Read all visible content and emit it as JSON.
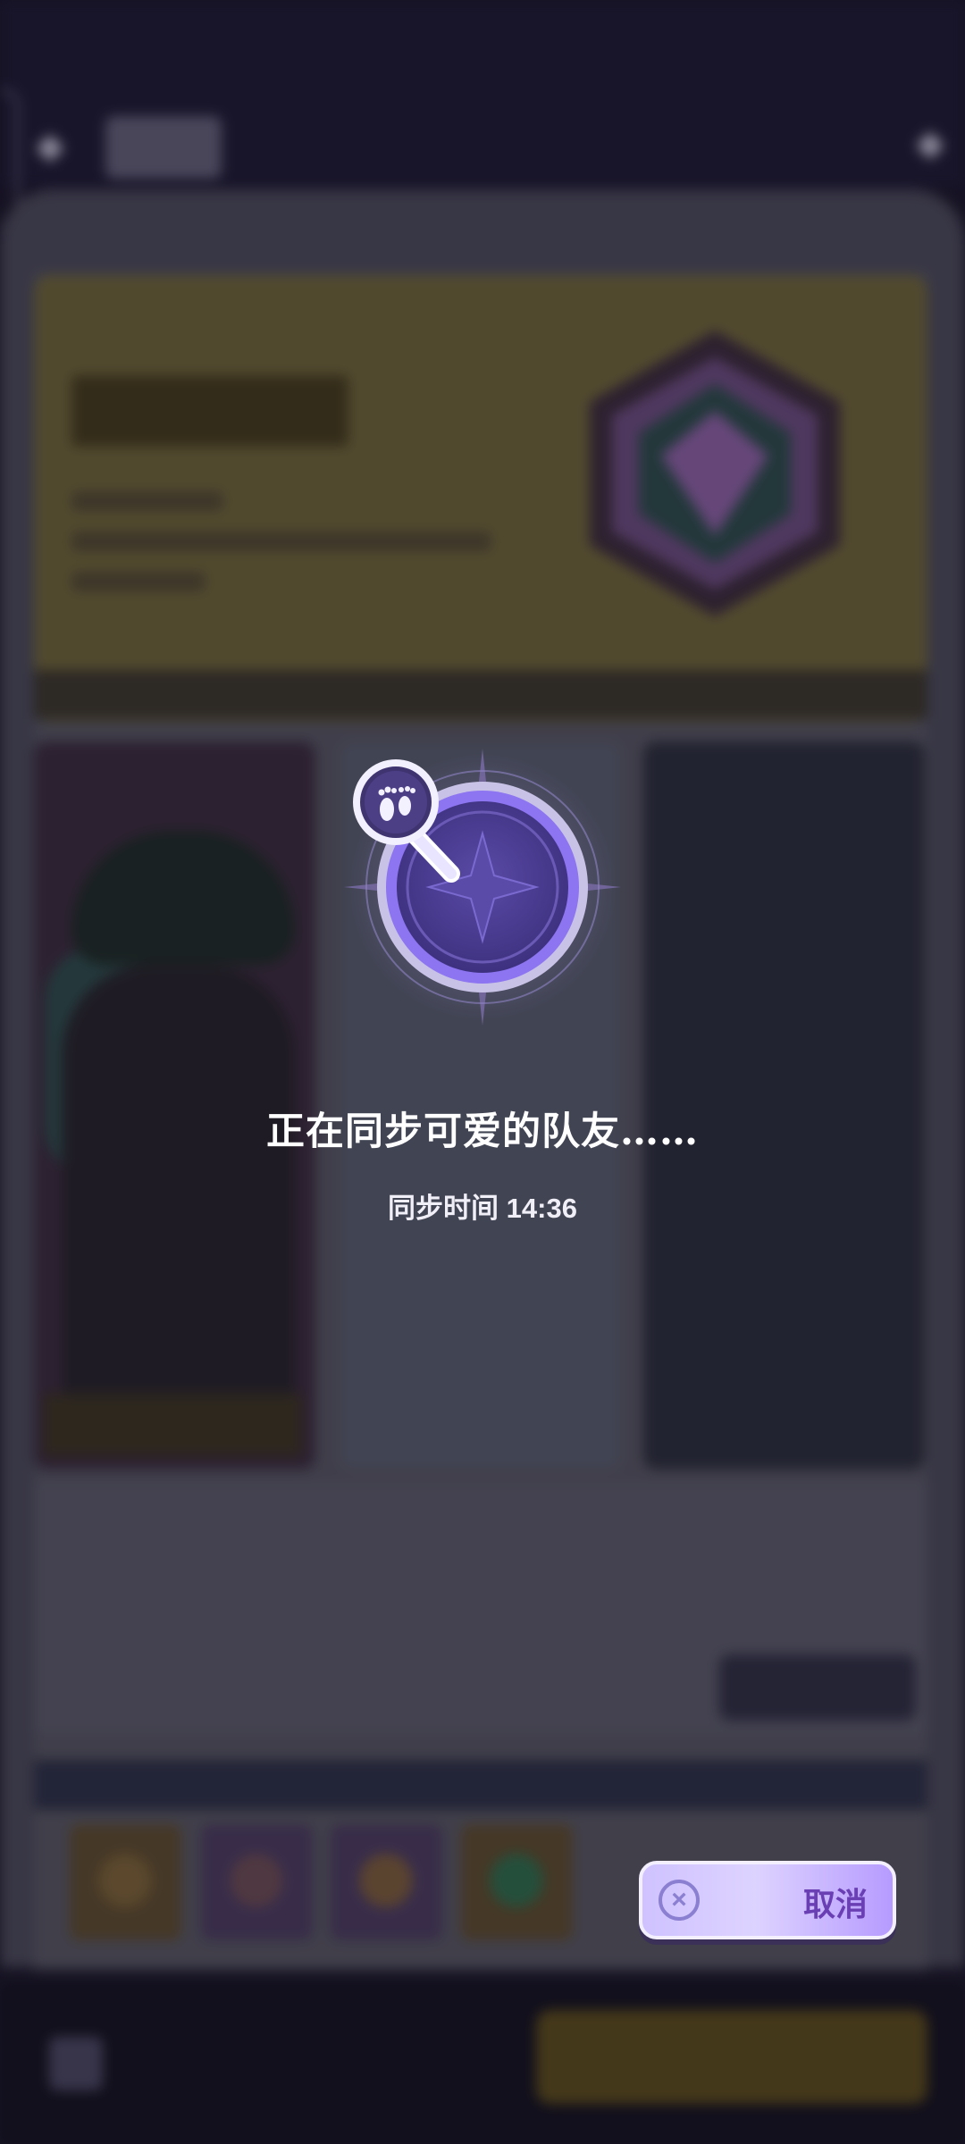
{
  "overlay": {
    "sync_title": "正在同步可爱的队友……",
    "sync_time_label": "同步时间",
    "sync_time_value": "14:36",
    "sync_time": "同步时间 14:36",
    "loader_icon": "footprint-magnifier-icon",
    "cancel_button": {
      "icon": "close-circle-icon",
      "label": "取消"
    }
  },
  "colors": {
    "background": "#1b1629",
    "loader_purple": "#4e3f96",
    "accent_violet": "#8d74f0",
    "cancel_text": "#6a3fb4"
  }
}
